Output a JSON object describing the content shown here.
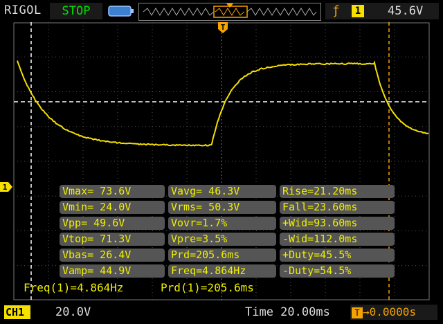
{
  "topbar": {
    "brand": "RIGOL",
    "run_state": "STOP",
    "trigger": {
      "edge_icon": "rising-edge-icon",
      "source": "1",
      "level": "45.6V"
    }
  },
  "colors": {
    "channel1": "#f5e000",
    "trigger": "#f5a300",
    "run_state": "#00e000",
    "cell_background": "#555555"
  },
  "measurements": [
    [
      "Vmax= 73.6V",
      "Vavg= 46.3V",
      "Rise=21.20ms"
    ],
    [
      "Vmin= 24.0V",
      "Vrms= 50.3V",
      "Fall=23.60ms"
    ],
    [
      "Vpp= 49.6V",
      "Vovr=1.7%",
      "+Wid=93.60ms"
    ],
    [
      "Vtop= 71.3V",
      "Vpre=3.5%",
      "-Wid=112.0ms"
    ],
    [
      "Vbas= 26.4V",
      "Prd=205.6ms",
      "+Duty=45.5%"
    ],
    [
      "Vamp= 44.9V",
      "Freq=4.864Hz",
      "-Duty=54.5%"
    ]
  ],
  "summary": {
    "freq": "Freq(1)=4.864Hz",
    "prd": "Prd(1)=205.6ms"
  },
  "markers": {
    "trigger_marker": "T",
    "channel_marker": "1"
  },
  "bottombar": {
    "channel_label": "CH1",
    "channel_scale": "20.0V",
    "timebase": "Time 20.00ms",
    "trigger_offset": "0.0000s"
  }
}
